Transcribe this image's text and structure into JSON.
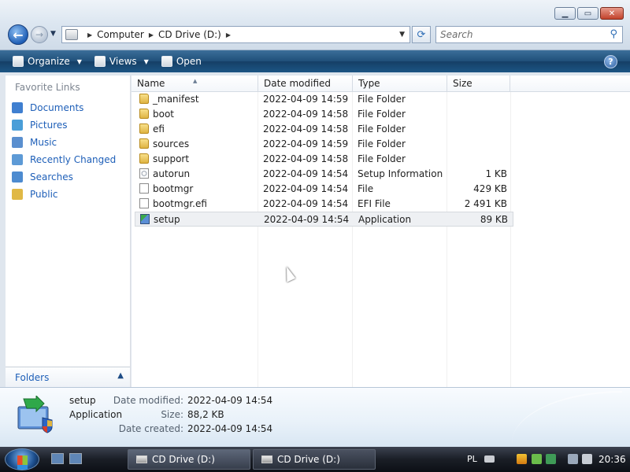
{
  "window": {
    "minimize_icon": "minimize-icon",
    "maximize_icon": "maximize-icon",
    "close_icon": "close-icon"
  },
  "address": {
    "crumbs": [
      "Computer",
      "CD Drive (D:)"
    ],
    "search_placeholder": "Search"
  },
  "toolbar": {
    "organize": "Organize",
    "views": "Views",
    "open": "Open"
  },
  "sidebar": {
    "title": "Favorite Links",
    "items": [
      {
        "label": "Documents",
        "icon": "documents-icon",
        "color": "#3f7fd0"
      },
      {
        "label": "Pictures",
        "icon": "pictures-icon",
        "color": "#4a9ed8"
      },
      {
        "label": "Music",
        "icon": "music-icon",
        "color": "#5a8fcf"
      },
      {
        "label": "Recently Changed",
        "icon": "recent-icon",
        "color": "#5d9ad6"
      },
      {
        "label": "Searches",
        "icon": "searches-icon",
        "color": "#4d8bd0"
      },
      {
        "label": "Public",
        "icon": "folder-icon",
        "color": "#e0b845"
      }
    ],
    "folders_label": "Folders"
  },
  "columns": [
    "Name",
    "Date modified",
    "Type",
    "Size"
  ],
  "files": [
    {
      "name": "_manifest",
      "date": "2022-04-09 14:59",
      "type": "File Folder",
      "size": "",
      "icon": "folder"
    },
    {
      "name": "boot",
      "date": "2022-04-09 14:58",
      "type": "File Folder",
      "size": "",
      "icon": "folder"
    },
    {
      "name": "efi",
      "date": "2022-04-09 14:58",
      "type": "File Folder",
      "size": "",
      "icon": "folder"
    },
    {
      "name": "sources",
      "date": "2022-04-09 14:59",
      "type": "File Folder",
      "size": "",
      "icon": "folder"
    },
    {
      "name": "support",
      "date": "2022-04-09 14:58",
      "type": "File Folder",
      "size": "",
      "icon": "folder"
    },
    {
      "name": "autorun",
      "date": "2022-04-09 14:54",
      "type": "Setup Information",
      "size": "1 KB",
      "icon": "settings-file"
    },
    {
      "name": "bootmgr",
      "date": "2022-04-09 14:54",
      "type": "File",
      "size": "429 KB",
      "icon": "file"
    },
    {
      "name": "bootmgr.efi",
      "date": "2022-04-09 14:54",
      "type": "EFI File",
      "size": "2 491 KB",
      "icon": "file"
    },
    {
      "name": "setup",
      "date": "2022-04-09 14:54",
      "type": "Application",
      "size": "89 KB",
      "icon": "application",
      "selected": true
    }
  ],
  "details": {
    "name": "setup",
    "type": "Application",
    "date_modified_label": "Date modified:",
    "date_modified": "2022-04-09 14:54",
    "size_label": "Size:",
    "size": "88,2 KB",
    "date_created_label": "Date created:",
    "date_created": "2022-04-09 14:54"
  },
  "taskbar": {
    "buttons": [
      "CD Drive (D:)",
      "CD Drive (D:)"
    ],
    "language": "PL",
    "clock": "20:36"
  }
}
